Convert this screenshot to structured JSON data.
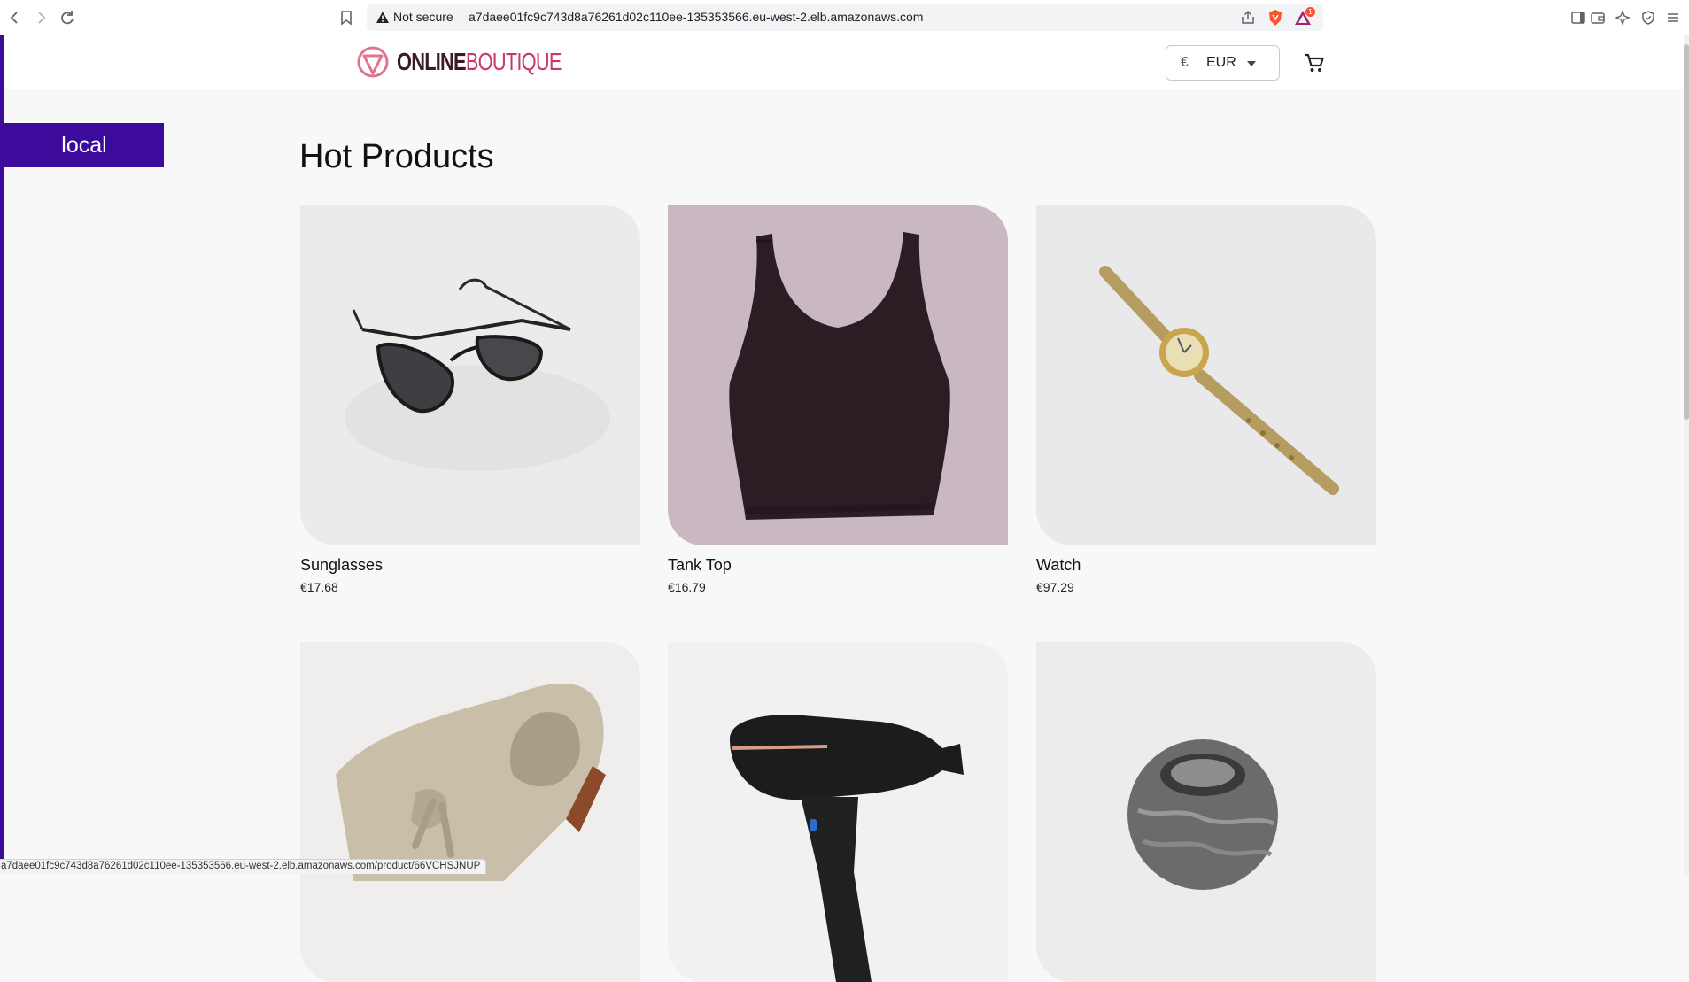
{
  "browser": {
    "security_label": "Not secure",
    "url": "a7daee01fc9c743d8a76261d02c110ee-135353566.eu-west-2.elb.amazonaws.com",
    "rewards_badge": "1",
    "status_url": "a7daee01fc9c743d8a76261d02c110ee-135353566.eu-west-2.elb.amazonaws.com/product/66VCHSJNUP"
  },
  "header": {
    "logo_bold": "ONLINE",
    "logo_light": "BOUTIQUE",
    "currency_symbol": "€",
    "currency_value": "EUR"
  },
  "env_badge": "local",
  "main": {
    "title": "Hot Products",
    "products": [
      {
        "name": "Sunglasses",
        "price": "€17.68",
        "image": "sunglasses"
      },
      {
        "name": "Tank Top",
        "price": "€16.79",
        "image": "tank-top"
      },
      {
        "name": "Watch",
        "price": "€97.29",
        "image": "watch"
      },
      {
        "name": "",
        "price": "",
        "image": "loafers"
      },
      {
        "name": "",
        "price": "",
        "image": "hair-dryer"
      },
      {
        "name": "",
        "price": "",
        "image": "candle-holder"
      }
    ]
  },
  "colors": {
    "accent": "#3d0b9c",
    "logo_pink": "#c8386a",
    "page_bg": "#f8f8f8"
  }
}
